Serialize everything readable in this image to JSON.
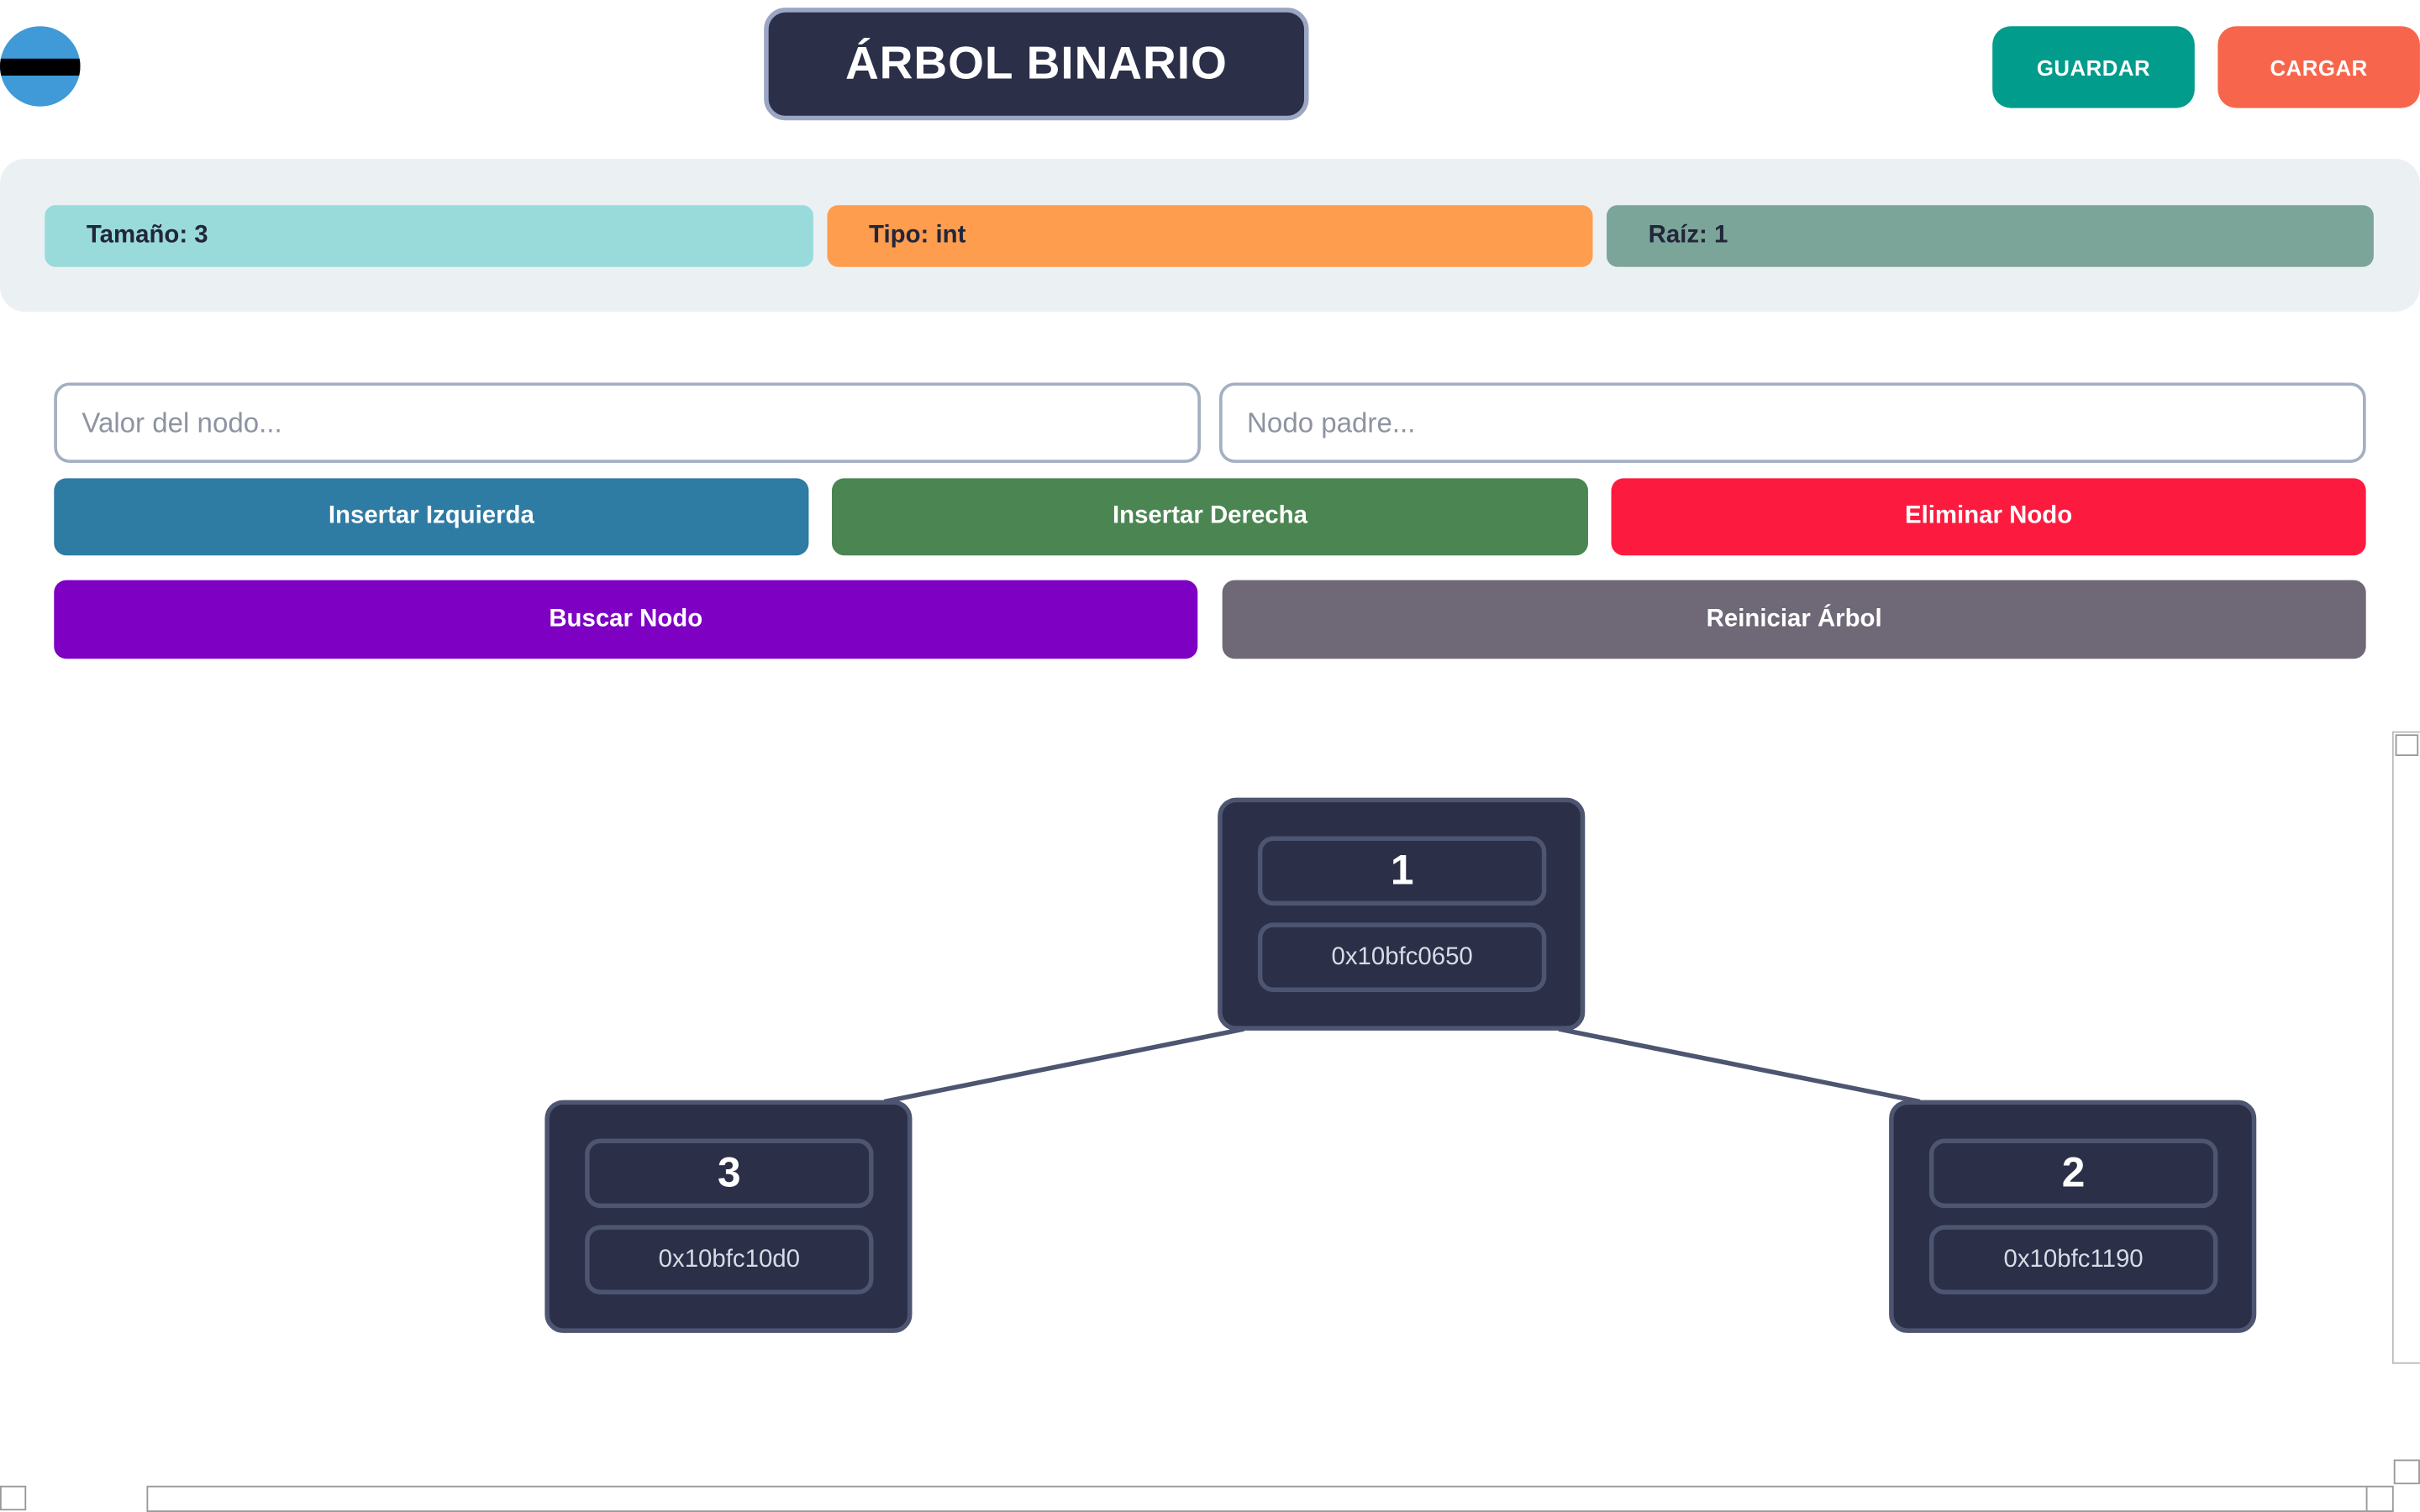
{
  "header": {
    "title": "ÁRBOL BINARIO",
    "save_label": "GUARDAR",
    "load_label": "CARGAR"
  },
  "stats": {
    "size": "Tamaño: 3",
    "type": "Tipo: int",
    "root": "Raíz: 1"
  },
  "inputs": {
    "value_placeholder": "Valor del nodo...",
    "parent_placeholder": "Nodo padre..."
  },
  "actions": {
    "insert_left": "Insertar Izquierda",
    "insert_right": "Insertar Derecha",
    "delete": "Eliminar Nodo",
    "search": "Buscar Nodo",
    "reset": "Reiniciar Árbol"
  },
  "tree": {
    "root": {
      "value": "1",
      "address": "0x10bfc0650"
    },
    "left": {
      "value": "3",
      "address": "0x10bfc10d0"
    },
    "right": {
      "value": "2",
      "address": "0x10bfc1190"
    }
  },
  "colors": {
    "node_bg": "#2b2f47",
    "edge": "#4d5571"
  }
}
